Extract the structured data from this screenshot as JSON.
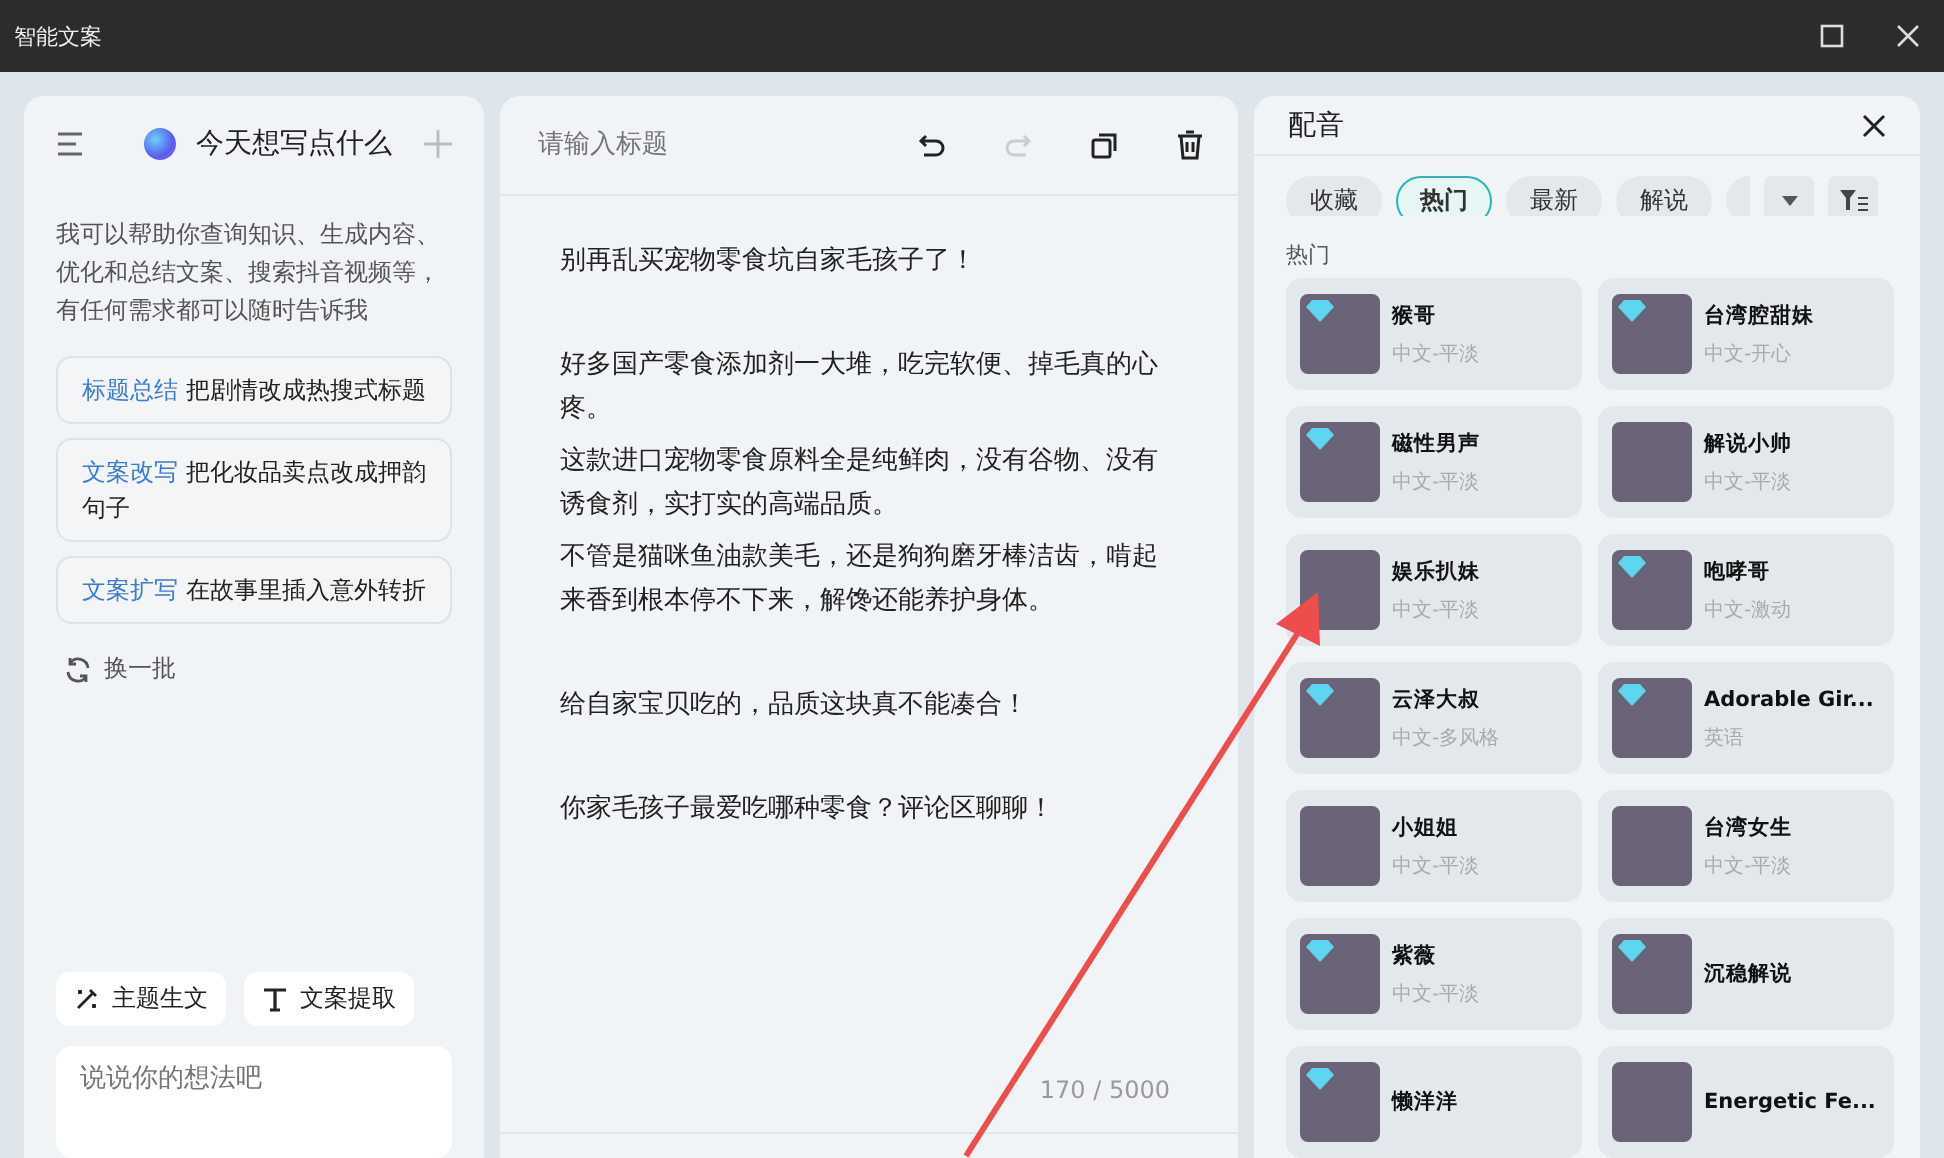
{
  "window": {
    "title": "智能文案"
  },
  "assistant": {
    "title": "今天想写点什么",
    "intro": "我可以帮助你查询知识、生成内容、优化和总结文案、搜索抖音视频等，有任何需求都可以随时告诉我",
    "suggestions": [
      {
        "tag": "标题总结",
        "text": "把剧情改成热搜式标题"
      },
      {
        "tag": "文案改写",
        "text": "把化妆品卖点改成押韵句子"
      },
      {
        "tag": "文案扩写",
        "text": "在故事里插入意外转折"
      }
    ],
    "refresh": "换一批",
    "tools": [
      {
        "kind": "wand",
        "label": "主题生文"
      },
      {
        "kind": "text",
        "label": "文案提取"
      }
    ],
    "input": {
      "placeholder": "说说你的想法吧"
    }
  },
  "editor": {
    "title_placeholder": "请输入标题",
    "redo_disabled": true,
    "paragraphs": [
      {
        "text": "别再乱买宠物零食坑自家毛孩子了！",
        "spaced": false
      },
      {
        "text": "好多国产零食添加剂一大堆，吃完软便、掉毛真的心疼。",
        "spaced": true
      },
      {
        "text": "这款进口宠物零食原料全是纯鲜肉，没有谷物、没有诱食剂，实打实的高端品质。",
        "spaced": false
      },
      {
        "text": "不管是猫咪鱼油款美毛，还是狗狗磨牙棒洁齿，啃起来香到根本停不下来，解馋还能养护身体。",
        "spaced": false
      },
      {
        "text": "给自家宝贝吃的，品质这块真不能凑合！",
        "spaced": true
      },
      {
        "text": "你家毛孩子最爱吃哪种零食？评论区聊聊！",
        "spaced": true
      }
    ],
    "counter": "170 / 5000"
  },
  "dubbing": {
    "title": "配音",
    "tabs": [
      {
        "label": "收藏",
        "selected": false
      },
      {
        "label": "热门",
        "selected": true
      },
      {
        "label": "最新",
        "selected": false
      },
      {
        "label": "解说",
        "selected": false
      }
    ],
    "section": "热门",
    "voices": [
      {
        "name": "猴哥",
        "style": "中文-平淡",
        "premium": true
      },
      {
        "name": "台湾腔甜妹",
        "style": "中文-开心",
        "premium": true
      },
      {
        "name": "磁性男声",
        "style": "中文-平淡",
        "premium": true
      },
      {
        "name": "解说小帅",
        "style": "中文-平淡",
        "premium": false
      },
      {
        "name": "娱乐扒妹",
        "style": "中文-平淡",
        "premium": false
      },
      {
        "name": "咆哮哥",
        "style": "中文-激动",
        "premium": true
      },
      {
        "name": "云泽大叔",
        "style": "中文-多风格",
        "premium": true
      },
      {
        "name": "Adorable Gir...",
        "style": "英语",
        "premium": true
      },
      {
        "name": "小姐姐",
        "style": "中文-平淡",
        "premium": false
      },
      {
        "name": "台湾女生",
        "style": "中文-平淡",
        "premium": false
      },
      {
        "name": "紫薇",
        "style": "中文-平淡",
        "premium": true
      },
      {
        "name": "沉稳解说",
        "premium": true
      },
      {
        "name": "懒洋洋",
        "premium": true
      },
      {
        "name": "Energetic Fe...",
        "premium": false
      }
    ]
  }
}
